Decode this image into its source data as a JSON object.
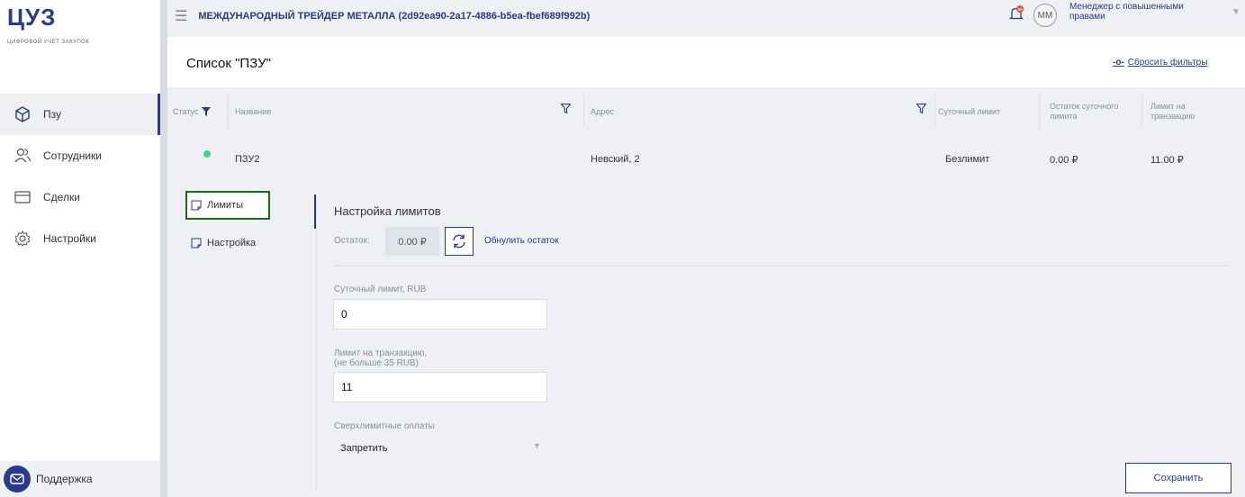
{
  "sidebar": {
    "logo": "ЦУЗ",
    "logo_sub": "ЦИФРОВОЙ УЧЁТ ЗАКУПОК",
    "items": [
      {
        "label": "Пзу",
        "icon": "cube-icon"
      },
      {
        "label": "Сотрудники",
        "icon": "users-icon"
      },
      {
        "label": "Сделки",
        "icon": "card-icon"
      },
      {
        "label": "Настройки",
        "icon": "gear-icon"
      }
    ],
    "support_label": "Поддержка"
  },
  "topbar": {
    "org": "МЕЖДУНАРОДНЫЙ ТРЕЙДЕР МЕТАЛЛА (2d92ea90-2a17-4886-b5ea-fbef689f992b)",
    "avatar_initials": "ММ",
    "user_role": "Менеджер с повышенными правами",
    "notification_badge": "99"
  },
  "header": {
    "title": "Список \"ПЗУ\"",
    "reset_filters": "Сбросить фильтры"
  },
  "table": {
    "columns": [
      "Статус",
      "Название",
      "Адрес",
      "Суточный лимит",
      "Остаток суточного лимита",
      "Лимит на транзакцию"
    ],
    "rows": [
      {
        "name": "ПЗУ2",
        "address": "Невский, 2",
        "daily_limit": "Безлимит",
        "daily_remaining": "0.00 ₽",
        "tx_limit": "11.00 ₽",
        "status_color": "#3dd68c"
      }
    ]
  },
  "details": {
    "tabs": [
      "Лимиты",
      "Настройка"
    ],
    "section_title": "Настройка лимитов",
    "remainder_label": "Остаток:",
    "remainder_value": "0.00 ₽",
    "reset_remainder": "Обнулить остаток",
    "daily_limit_label": "Суточный лимит, RUB",
    "daily_limit_value": "0",
    "tx_limit_label_line1": "Лимит на транзакцию,",
    "tx_limit_label_line2": "(не больше 35 RUB)",
    "tx_limit_value": "11",
    "overlimit_label": "Сверхлимитные оплаты",
    "overlimit_value": "Запретить",
    "save_label": "Сохранить"
  },
  "colors": {
    "accent": "#2a3a8c",
    "status_active": "#3dd68c",
    "focus_border": "#1a6b1a"
  }
}
